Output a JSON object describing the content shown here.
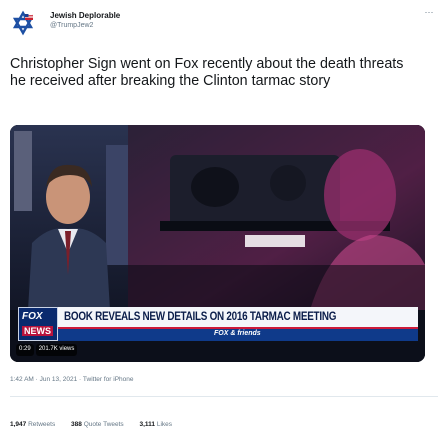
{
  "author": {
    "display_name": "Jewish Deplorable",
    "handle": "@TrumpJew2",
    "avatar_icon": "star-of-david-avatar-icon"
  },
  "more_icon": "ellipsis-icon",
  "more_label": "···",
  "tweet_text": "Christopher Sign went on Fox recently about the death threats he received after breaking the Clinton tarmac story",
  "video": {
    "network_logo_top": "FOX",
    "network_logo_bottom": "NEWS",
    "headline": "BOOK REVEALS NEW DETAILS ON 2016 TARMAC MEETING",
    "show_bug": "FOX & friends",
    "duration": "0:29",
    "views": "201.7K views"
  },
  "timestamp": {
    "time": "1:42 AM",
    "separator1": " · ",
    "date": "Jun 13, 2021",
    "separator2": " · ",
    "source": "Twitter for iPhone"
  },
  "stats": {
    "retweets_count": "1,947",
    "retweets_label": "Retweets",
    "quotes_count": "388",
    "quotes_label": "Quote Tweets",
    "likes_count": "3,111",
    "likes_label": "Likes"
  },
  "colors": {
    "text_primary": "#14171a",
    "text_secondary": "#657786",
    "divider": "#e1e8ed",
    "fox_blue": "#0a2a6e",
    "fox_red": "#cc1a3a"
  }
}
